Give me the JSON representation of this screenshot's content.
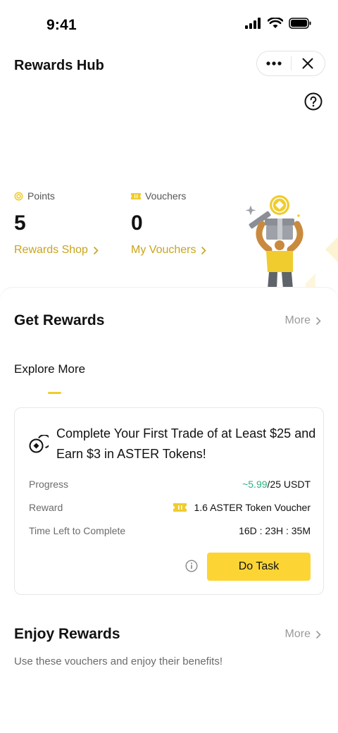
{
  "status_bar": {
    "time": "9:41"
  },
  "header": {
    "title": "Rewards Hub"
  },
  "stats": {
    "points": {
      "label": "Points",
      "value": "5",
      "link": "Rewards Shop"
    },
    "vouchers": {
      "label": "Vouchers",
      "value": "0",
      "link": "My Vouchers"
    }
  },
  "get_rewards": {
    "title": "Get Rewards",
    "more": "More",
    "tab": "Explore More",
    "task": {
      "title": "Complete Your First Trade of at Least $25 and Earn $3 in ASTER Tokens!",
      "progress_label": "Progress",
      "progress_current": "~5.99",
      "progress_total": "/25 USDT",
      "reward_label": "Reward",
      "reward_value": "1.6 ASTER Token Voucher",
      "time_label": "Time Left to Complete",
      "time_value": "16D : 23H : 35M",
      "button": "Do Task"
    }
  },
  "enjoy_rewards": {
    "title": "Enjoy Rewards",
    "more": "More",
    "subtitle": "Use these vouchers and enjoy their benefits!"
  },
  "colors": {
    "accent": "#fcd535",
    "link": "#c9a41c",
    "positive": "#2bb37b"
  }
}
